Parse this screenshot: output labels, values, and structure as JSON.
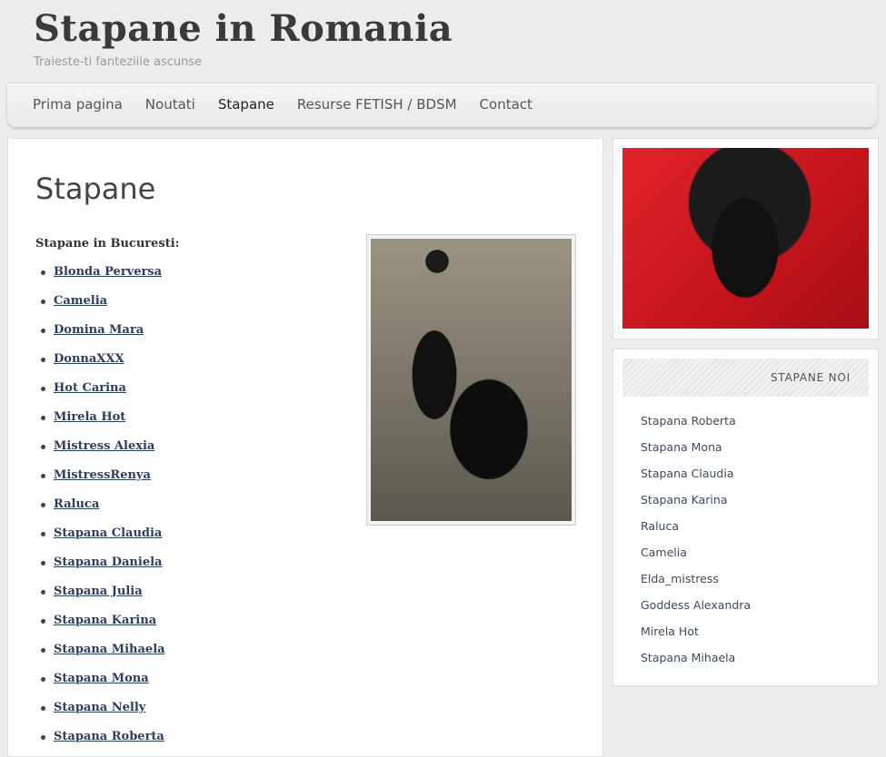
{
  "site": {
    "title": "Stapane in Romania",
    "tagline": "Traieste-ti fanteziile ascunse"
  },
  "nav": {
    "items": [
      {
        "label": "Prima pagina"
      },
      {
        "label": "Noutati"
      },
      {
        "label": "Stapane"
      },
      {
        "label": "Resurse FETISH / BDSM"
      },
      {
        "label": "Contact"
      }
    ],
    "active": "Stapane"
  },
  "main": {
    "page_title": "Stapane",
    "section_label": "Stapane in Bucuresti:",
    "list": [
      "Blonda Perversa",
      "Camelia",
      "Domina Mara",
      "DonnaXXX",
      "Hot Carina",
      "Mirela Hot",
      "Mistress Alexia",
      "MistressRenya",
      "Raluca",
      "Stapana Claudia",
      "Stapana Daniela",
      "Stapana Julia",
      "Stapana Karina",
      "Stapana Mihaela",
      "Stapana Mona",
      "Stapana Nelly",
      "Stapana Roberta"
    ]
  },
  "sidebar": {
    "widget_title": "STAPANE NOI",
    "items": [
      "Stapana Roberta",
      "Stapana Mona",
      "Stapana Claudia",
      "Stapana Karina",
      "Raluca",
      "Camelia",
      "Elda_mistress",
      "Goddess Alexandra",
      "Mirela Hot",
      "Stapana Mihaela"
    ]
  }
}
